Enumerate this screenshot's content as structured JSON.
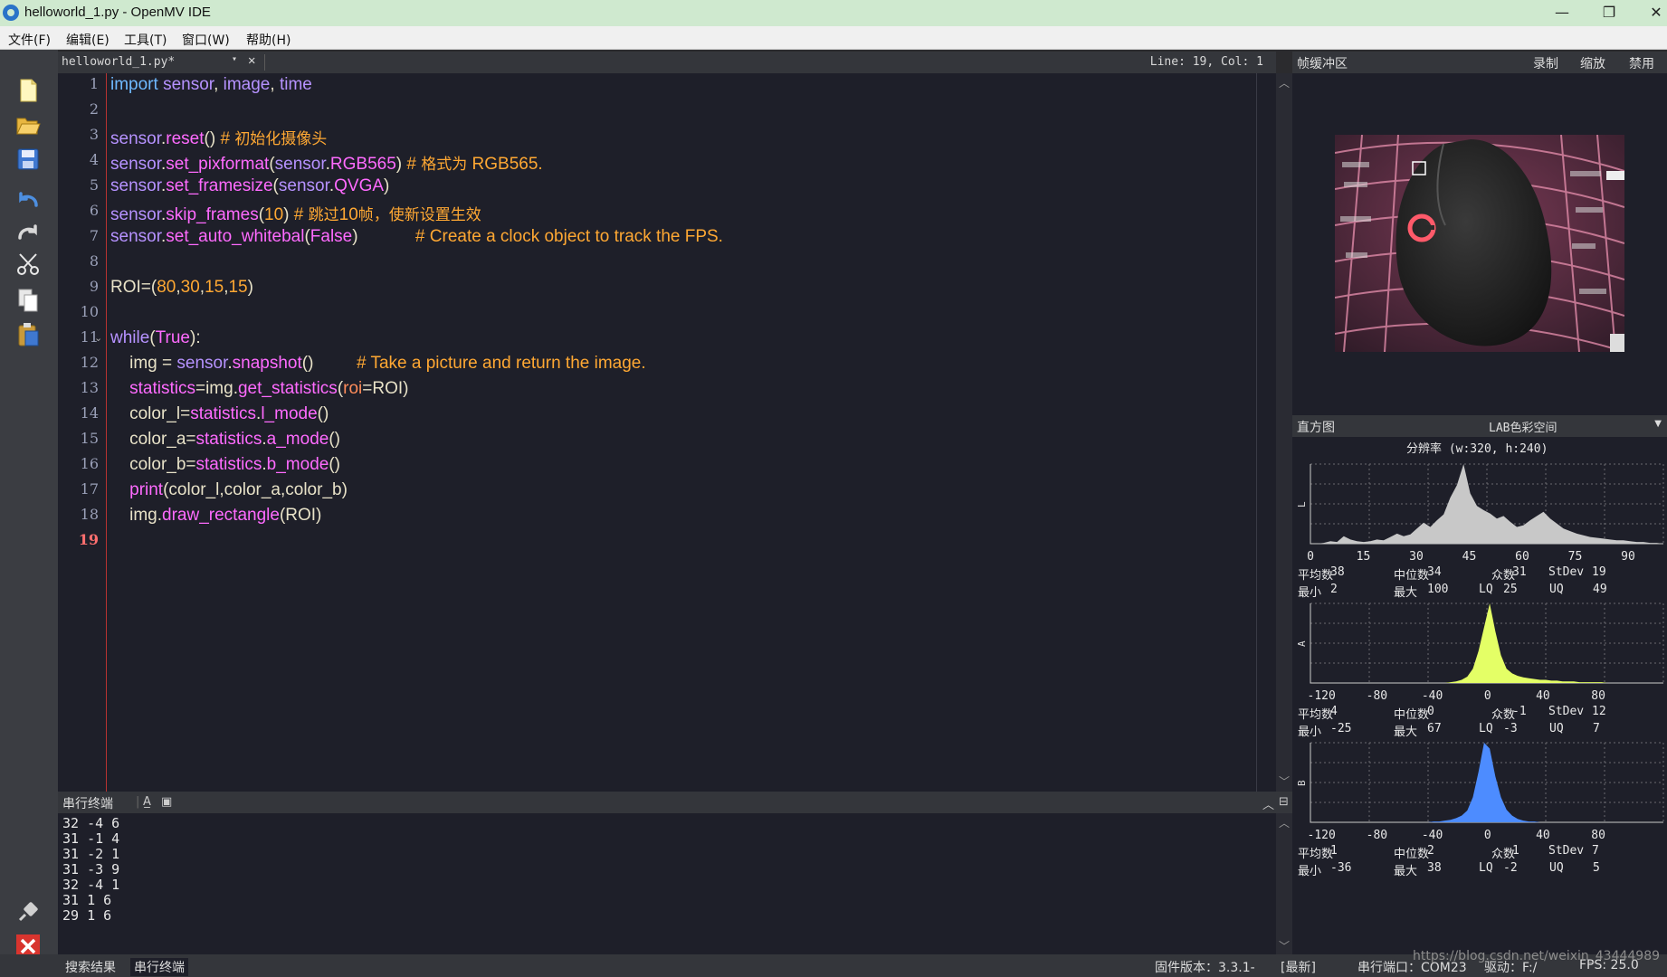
{
  "window": {
    "title": "helloworld_1.py - OpenMV IDE",
    "minimize": "—",
    "restore": "❐",
    "close": "✕"
  },
  "menu": [
    "文件(F)",
    "编辑(E)",
    "工具(T)",
    "窗口(W)",
    "帮助(H)"
  ],
  "toolbar_icons": [
    "new-file-icon",
    "open-folder-icon",
    "save-icon",
    "undo-icon",
    "redo-icon",
    "cut-icon",
    "copy-icon",
    "paste-icon"
  ],
  "editor": {
    "tab_name": "helloworld_1.py*",
    "tab_dropdown": "▾",
    "tab_close": "✕",
    "cursor_position": "Line: 19, Col: 1",
    "line_numbers": [
      "1",
      "2",
      "3",
      "4",
      "5",
      "6",
      "7",
      "8",
      "9",
      "10",
      "11",
      "12",
      "13",
      "14",
      "15",
      "16",
      "17",
      "18",
      "19"
    ],
    "active_line": "19",
    "fold_marker": "⌄",
    "lines": [
      [
        {
          "t": "import ",
          "c": "kw"
        },
        {
          "t": "sensor",
          "c": "kw2"
        },
        {
          "t": ", ",
          "c": "pl"
        },
        {
          "t": "image",
          "c": "kw2"
        },
        {
          "t": ", ",
          "c": "pl"
        },
        {
          "t": "time",
          "c": "kw2"
        }
      ],
      [],
      [
        {
          "t": "sensor",
          "c": "kw2"
        },
        {
          "t": ".",
          "c": "pl"
        },
        {
          "t": "reset",
          "c": "fn"
        },
        {
          "t": "() ",
          "c": "pl"
        },
        {
          "t": "# ",
          "c": "cm"
        },
        {
          "t": "初始化摄像头",
          "c": "cmz"
        }
      ],
      [
        {
          "t": "sensor",
          "c": "kw2"
        },
        {
          "t": ".",
          "c": "pl"
        },
        {
          "t": "set_pixformat",
          "c": "fn"
        },
        {
          "t": "(",
          "c": "pl"
        },
        {
          "t": "sensor",
          "c": "kw2"
        },
        {
          "t": ".",
          "c": "pl"
        },
        {
          "t": "RGB565",
          "c": "fn"
        },
        {
          "t": ") ",
          "c": "pl"
        },
        {
          "t": "# ",
          "c": "cm"
        },
        {
          "t": "格式为",
          "c": "cmz"
        },
        {
          "t": " RGB565.",
          "c": "cm"
        }
      ],
      [
        {
          "t": "sensor",
          "c": "kw2"
        },
        {
          "t": ".",
          "c": "pl"
        },
        {
          "t": "set_framesize",
          "c": "fn"
        },
        {
          "t": "(",
          "c": "pl"
        },
        {
          "t": "sensor",
          "c": "kw2"
        },
        {
          "t": ".",
          "c": "pl"
        },
        {
          "t": "QVGA",
          "c": "fn"
        },
        {
          "t": ")",
          "c": "pl"
        }
      ],
      [
        {
          "t": "sensor",
          "c": "kw2"
        },
        {
          "t": ".",
          "c": "pl"
        },
        {
          "t": "skip_frames",
          "c": "fn"
        },
        {
          "t": "(",
          "c": "pl"
        },
        {
          "t": "10",
          "c": "nm"
        },
        {
          "t": ") ",
          "c": "pl"
        },
        {
          "t": "# ",
          "c": "cm"
        },
        {
          "t": "跳过",
          "c": "cmz"
        },
        {
          "t": "10",
          "c": "cm"
        },
        {
          "t": "帧，使新设置生效",
          "c": "cmz"
        }
      ],
      [
        {
          "t": "sensor",
          "c": "kw2"
        },
        {
          "t": ".",
          "c": "pl"
        },
        {
          "t": "set_auto_whitebal",
          "c": "fn"
        },
        {
          "t": "(",
          "c": "pl"
        },
        {
          "t": "False",
          "c": "fn"
        },
        {
          "t": ")            ",
          "c": "pl"
        },
        {
          "t": "# Create a clock object to track the FPS.",
          "c": "cm"
        }
      ],
      [],
      [
        {
          "t": "ROI",
          "c": "pl"
        },
        {
          "t": "=(",
          "c": "pl"
        },
        {
          "t": "80",
          "c": "nm"
        },
        {
          "t": ",",
          "c": "pl"
        },
        {
          "t": "30",
          "c": "nm"
        },
        {
          "t": ",",
          "c": "pl"
        },
        {
          "t": "15",
          "c": "nm"
        },
        {
          "t": ",",
          "c": "pl"
        },
        {
          "t": "15",
          "c": "nm"
        },
        {
          "t": ")",
          "c": "pl"
        }
      ],
      [],
      [
        {
          "t": "while",
          "c": "kw2"
        },
        {
          "t": "(",
          "c": "pl"
        },
        {
          "t": "True",
          "c": "fn"
        },
        {
          "t": "):",
          "c": "pl"
        }
      ],
      [
        {
          "t": "    img = ",
          "c": "pl"
        },
        {
          "t": "sensor",
          "c": "kw2"
        },
        {
          "t": ".",
          "c": "pl"
        },
        {
          "t": "snapshot",
          "c": "fn"
        },
        {
          "t": "()         ",
          "c": "pl"
        },
        {
          "t": "# Take a picture and return the image.",
          "c": "cm"
        }
      ],
      [
        {
          "t": "    ",
          "c": "pl"
        },
        {
          "t": "statistics",
          "c": "fn"
        },
        {
          "t": "=img.",
          "c": "pl"
        },
        {
          "t": "get_statistics",
          "c": "fn"
        },
        {
          "t": "(",
          "c": "pl"
        },
        {
          "t": "roi",
          "c": "pa"
        },
        {
          "t": "=ROI)",
          "c": "pl"
        }
      ],
      [
        {
          "t": "    color_l=",
          "c": "pl"
        },
        {
          "t": "statistics",
          "c": "fn"
        },
        {
          "t": ".",
          "c": "pl"
        },
        {
          "t": "l_mode",
          "c": "fn"
        },
        {
          "t": "()",
          "c": "pl"
        }
      ],
      [
        {
          "t": "    color_a=",
          "c": "pl"
        },
        {
          "t": "statistics",
          "c": "fn"
        },
        {
          "t": ".",
          "c": "pl"
        },
        {
          "t": "a_mode",
          "c": "fn"
        },
        {
          "t": "()",
          "c": "pl"
        }
      ],
      [
        {
          "t": "    color_b=",
          "c": "pl"
        },
        {
          "t": "statistics",
          "c": "fn"
        },
        {
          "t": ".",
          "c": "pl"
        },
        {
          "t": "b_mode",
          "c": "fn"
        },
        {
          "t": "()",
          "c": "pl"
        }
      ],
      [
        {
          "t": "    ",
          "c": "pl"
        },
        {
          "t": "print",
          "c": "fn"
        },
        {
          "t": "(color_l,color_a,color_b)",
          "c": "pl"
        }
      ],
      [
        {
          "t": "    img.",
          "c": "pl"
        },
        {
          "t": "draw_rectangle",
          "c": "fn"
        },
        {
          "t": "(ROI)",
          "c": "pl"
        }
      ],
      []
    ]
  },
  "terminal": {
    "title": "串行终端",
    "lines": [
      "32 -4 6",
      "31 -1 4",
      "31 -2 1",
      "31 -3 9",
      "32 -4 1",
      "31 1 6",
      "29 1 6"
    ]
  },
  "framebuffer": {
    "title": "帧缓冲区",
    "record": "录制",
    "zoom": "缩放",
    "disable": "禁用"
  },
  "histogram": {
    "title": "直方图",
    "color_space": "LAB色彩空间",
    "resolution": "分辨率 (w:320, h:240)",
    "channels": [
      {
        "name": "L",
        "color": "#c8c8c8",
        "ticks": [
          "0",
          "15",
          "30",
          "45",
          "60",
          "75",
          "90"
        ],
        "xrange": [
          0,
          100
        ],
        "values": [
          0,
          0,
          1,
          3,
          2,
          9,
          5,
          3,
          2,
          3,
          5,
          4,
          8,
          12,
          9,
          11,
          18,
          25,
          20,
          28,
          35,
          55,
          70,
          95,
          60,
          45,
          40,
          36,
          30,
          33,
          26,
          20,
          22,
          28,
          33,
          38,
          30,
          24,
          18,
          15,
          12,
          10,
          8,
          7,
          6,
          5,
          4,
          4,
          3,
          2,
          2,
          1,
          1,
          0
        ],
        "mean_label": "平均数",
        "mean": "38",
        "median_label": "中位数",
        "median": "34",
        "mode_label": "众数",
        "mode": "31",
        "stdev_label": "StDev",
        "stdev": "19",
        "min_label": "最小",
        "min": "2",
        "max_label": "最大",
        "max": "100",
        "lq_label": "LQ",
        "lq": "25",
        "uq_label": "UQ",
        "uq": "49"
      },
      {
        "name": "A",
        "color": "#e4ff66",
        "ticks": [
          "-120",
          "-80",
          "-40",
          "0",
          "40",
          "80"
        ],
        "xrange": [
          -128,
          127
        ],
        "values": [
          0,
          0,
          0,
          0,
          0,
          0,
          0,
          0,
          0,
          0,
          0,
          0,
          0,
          0,
          0,
          0,
          0,
          0,
          0,
          0,
          0,
          0,
          0,
          0,
          0,
          1,
          2,
          4,
          8,
          18,
          40,
          70,
          100,
          65,
          35,
          18,
          12,
          9,
          7,
          6,
          5,
          4,
          4,
          3,
          3,
          2,
          2,
          2,
          1,
          1,
          1,
          1,
          1,
          0,
          0,
          0,
          0,
          0,
          0,
          0,
          0,
          0,
          0,
          0
        ],
        "mean_label": "平均数",
        "mean": "4",
        "median_label": "中位数",
        "median": "0",
        "mode_label": "众数",
        "mode": "-1",
        "stdev_label": "StDev",
        "stdev": "12",
        "min_label": "最小",
        "min": "-25",
        "max_label": "最大",
        "max": "67",
        "lq_label": "LQ",
        "lq": "-3",
        "uq_label": "UQ",
        "uq": "7"
      },
      {
        "name": "B",
        "color": "#4d8cff",
        "ticks": [
          "-120",
          "-80",
          "-40",
          "0",
          "40",
          "80"
        ],
        "xrange": [
          -128,
          127
        ],
        "values": [
          0,
          0,
          0,
          0,
          0,
          0,
          0,
          0,
          0,
          0,
          0,
          0,
          0,
          0,
          0,
          0,
          0,
          0,
          0,
          0,
          0,
          0,
          1,
          1,
          2,
          3,
          5,
          8,
          14,
          30,
          60,
          95,
          88,
          55,
          30,
          15,
          8,
          4,
          2,
          1,
          1,
          0,
          0,
          0,
          0,
          0,
          0,
          0,
          0,
          0,
          0,
          0,
          0,
          0,
          0,
          0,
          0,
          0,
          0,
          0,
          0,
          0,
          0,
          0
        ],
        "mean_label": "平均数",
        "mean": "1",
        "median_label": "中位数",
        "median": "2",
        "mode_label": "众数",
        "mode": "1",
        "stdev_label": "StDev",
        "stdev": "7",
        "min_label": "最小",
        "min": "-36",
        "max_label": "最大",
        "max": "38",
        "lq_label": "LQ",
        "lq": "-2",
        "uq_label": "UQ",
        "uq": "5"
      }
    ]
  },
  "statusbar": {
    "search_results": "搜索结果",
    "serial_terminal": "串行终端",
    "firmware": "固件版本：3.3.1-",
    "latest": "[最新]",
    "serial_port": "串行端口：COM23",
    "driver": "驱动：F:/",
    "fps": "FPS: 25.0",
    "watermark": "https://blog.csdn.net/weixin_43444989"
  }
}
